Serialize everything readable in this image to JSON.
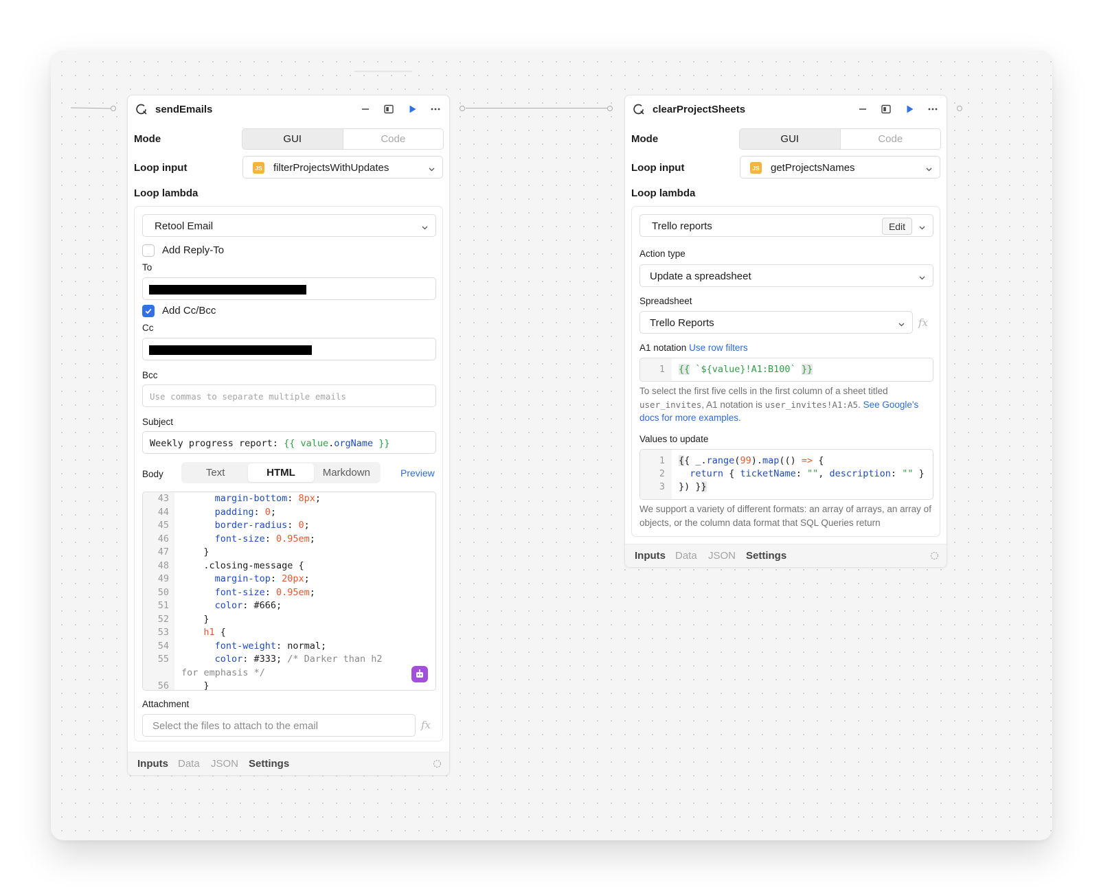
{
  "left_panel": {
    "title": "sendEmails",
    "mode_label": "Mode",
    "mode_gui": "GUI",
    "mode_code": "Code",
    "loop_input_label": "Loop input",
    "loop_input_value": "filterProjectsWithUpdates",
    "loop_lambda_label": "Loop lambda",
    "resource_value": "Retool Email",
    "add_reply_to": "Add Reply-To",
    "to_label": "To",
    "add_cc_bcc": "Add Cc/Bcc",
    "cc_label": "Cc",
    "bcc_label": "Bcc",
    "bcc_placeholder": "Use commas to separate multiple emails",
    "subject_label": "Subject",
    "subject_prefix": "Weekly progress report: ",
    "subject_tpl_open": "{{ ",
    "subject_tpl_var": "value",
    "subject_tpl_dot": ".",
    "subject_tpl_prop": "orgName",
    "subject_tpl_close": " }}",
    "body_label": "Body",
    "body_tabs": [
      "Text",
      "HTML",
      "Markdown"
    ],
    "preview": "Preview",
    "code_lines": [
      {
        "n": "43",
        "p": "margin-bottom",
        "v": "8px",
        "vt": "n",
        "ind": 6
      },
      {
        "n": "44",
        "p": "padding",
        "v": "0",
        "vt": "n",
        "ind": 6
      },
      {
        "n": "45",
        "p": "border-radius",
        "v": "0",
        "vt": "n",
        "ind": 6
      },
      {
        "n": "46",
        "p": "font-size",
        "v": "0.95em",
        "vt": "n",
        "ind": 6
      },
      {
        "n": "47",
        "raw": "}",
        "ind": 4
      },
      {
        "n": "48",
        "raw": ".closing-message {",
        "ind": 4
      },
      {
        "n": "49",
        "p": "margin-top",
        "v": "20px",
        "vt": "n",
        "ind": 6
      },
      {
        "n": "50",
        "p": "font-size",
        "v": "0.95em",
        "vt": "n",
        "ind": 6
      },
      {
        "n": "51",
        "p": "color",
        "v": "#666",
        "vt": "t",
        "ind": 6
      },
      {
        "n": "52",
        "raw": "}",
        "ind": 4
      },
      {
        "n": "53",
        "sel": "h1",
        "raw": " {",
        "ind": 4
      },
      {
        "n": "54",
        "p": "font-weight",
        "v": "normal",
        "vt": "t",
        "ind": 6
      },
      {
        "n": "55",
        "p": "color",
        "v": "#333",
        "vt": "t",
        "ind": 6,
        "comment": "/* Darker than h2"
      },
      {
        "n": "",
        "cont": "for emphasis */",
        "ind": 0
      },
      {
        "n": "56",
        "raw": "}",
        "ind": 4
      }
    ],
    "attachment_label": "Attachment",
    "attachment_placeholder": "Select the files to attach to the email",
    "footer_tabs": [
      "Inputs",
      "Data",
      "JSON",
      "Settings"
    ]
  },
  "right_panel": {
    "title": "clearProjectSheets",
    "mode_label": "Mode",
    "mode_gui": "GUI",
    "mode_code": "Code",
    "loop_input_label": "Loop input",
    "loop_input_value": "getProjectsNames",
    "loop_lambda_label": "Loop lambda",
    "resource_value": "Trello reports",
    "edit_label": "Edit",
    "action_type_label": "Action type",
    "action_type_value": "Update a spreadsheet",
    "spreadsheet_label": "Spreadsheet",
    "spreadsheet_value": "Trello Reports",
    "a1_label": "A1 notation",
    "a1_link": "Use row filters",
    "a1_line_no": "1",
    "a1_open": "{{",
    "a1_str": " `${value}!A1:B100` ",
    "a1_close": "}}",
    "a1_help_1": "To select the first five cells in the first column of a sheet titled",
    "a1_help_code1": "user_invites",
    "a1_help_2": ", A1 notation is ",
    "a1_help_code2": "user_invites!A1:A5",
    "a1_help_3": ". ",
    "a1_help_link1": "See",
    "a1_help_link2": "Google's docs for more examples.",
    "values_label": "Values to update",
    "values_line_nos": [
      "1",
      "2",
      "3"
    ],
    "values_help": "We support a variety of different formats: an array of arrays, an array of objects, or the column data format that SQL Queries return",
    "footer_tabs": [
      "Inputs",
      "Data",
      "JSON",
      "Settings"
    ]
  },
  "colors": {
    "accent": "#3170e8",
    "keyword": "#1f4bbd",
    "number": "#e4572e",
    "string": "#2f9e44",
    "js_badge": "#f2b63a",
    "ai_button": "#a24fd9"
  }
}
